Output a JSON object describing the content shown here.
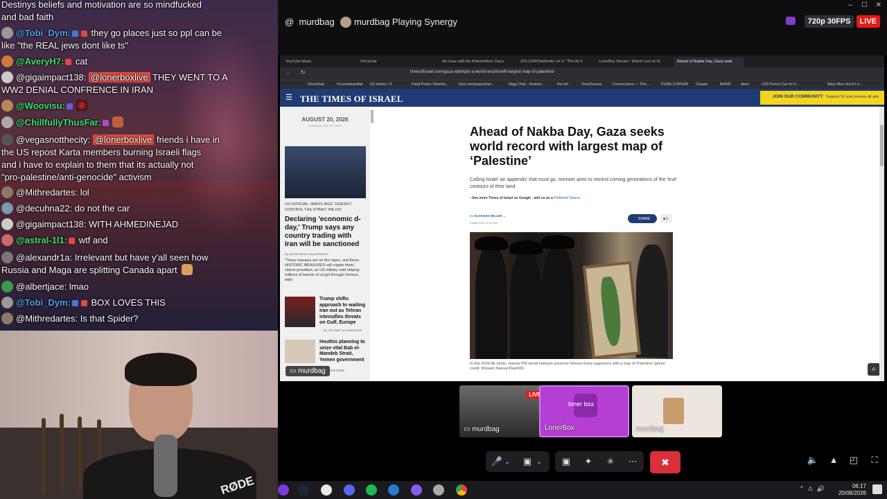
{
  "chat": {
    "messages": [
      {
        "user": "",
        "text": "Destinys beliefs and motivation are so mindfucked"
      },
      {
        "user": "",
        "text": "and bad faith"
      },
      {
        "user": "@Tobi_Dym:",
        "user_color": "#4aa3e8",
        "text": "they go places just so ppl can be",
        "avatar": "#999"
      },
      {
        "user": "",
        "text": "like \"the REAL jews dont like ts\""
      },
      {
        "user": "@AveryH7:",
        "user_color": "#3ee06c",
        "text": "cat",
        "avatar": "#d07a3a"
      },
      {
        "user": "@gigaimpact138:",
        "user_color": "#fff",
        "mention": "@lonerboxlive",
        "text": "THEY WENT TO A",
        "avatar": "#ccc"
      },
      {
        "user": "",
        "text": "WW2 DENIAL CONFRENCE IN IRAN"
      },
      {
        "user": "@Woovisu:",
        "user_color": "#3ee06c",
        "text": "",
        "avatar": "#b88a5a"
      },
      {
        "user": "@ChillfullyThusFar:",
        "user_color": "#3ee06c",
        "text": "",
        "avatar": "#aaa"
      },
      {
        "user": "@vegasnotthecity:",
        "user_color": "#fff",
        "mention": "@lonerboxlive",
        "text": "friends i have in",
        "avatar": "#555"
      },
      {
        "user": "",
        "text": "the US repost Karta members burning Israeli flags"
      },
      {
        "user": "",
        "text": "and i have to explain to them that its actually not"
      },
      {
        "user": "",
        "text": "\"pro-palestine/anti-genocide\" activism"
      },
      {
        "user": "@Mithredartes:",
        "user_color": "#fff",
        "text": "lol",
        "avatar": "#8a7a6a"
      },
      {
        "user": "@decuhna22:",
        "user_color": "#fff",
        "text": "do not the car",
        "avatar": "#7a9ab0"
      },
      {
        "user": "@gigaimpact138:",
        "user_color": "#fff",
        "text": "WITH AHMEDINEJAD",
        "avatar": "#ccc"
      },
      {
        "user": "@astral-1l1:",
        "user_color": "#3ee06c",
        "text": "wtf and",
        "avatar": "#c86a6a"
      },
      {
        "user": "@alexandr1a:",
        "user_color": "#fff",
        "text": "Irrelevant but have y'all seen how",
        "avatar": "#777"
      },
      {
        "user": "",
        "text": "Russia and Maga are splitting Canada apart"
      },
      {
        "user": "@albertjace:",
        "user_color": "#fff",
        "text": "lmao",
        "avatar": "#3a9a4a"
      },
      {
        "user": "@Tobi_Dym:",
        "user_color": "#4aa3e8",
        "text": "BOX LOVES THIS",
        "avatar": "#999"
      },
      {
        "user": "@Mithredartes:",
        "user_color": "#fff",
        "text": "Is that Spider?",
        "avatar": "#8a7a6a"
      }
    ]
  },
  "webcam": {
    "mic_brand": "RØDE"
  },
  "topbar": {
    "username": "murdbag",
    "stream_title": "murdbag Playing Synergy",
    "quality": "720p 30FPS",
    "live": "LIVE"
  },
  "browser": {
    "tabs": [
      "YouTube Music",
      "Omnichat",
      "An issue with the Antisemitism Discu",
      "(20) OSINTdefender on X: \"The Air F",
      "LonerBox Stream - Watch Live on Ki",
      "Ahead of Nakba Day, Gaza seek"
    ],
    "url": "timesofisrael.com/gaza-attempts-a-world-record-with-largest-map-of-palestine/",
    "bookmarks": [
      "Omnichat",
      "r/Livestreamfail",
      "(X) Home / X",
      "Fatal Police Shootin...",
      "kick.com/popout/an...",
      "Digg Chat - Destiny...",
      "the list",
      "TimeGuessr",
      "Connections — The...",
      "PURE COPIUM",
      "Claude",
      "BHND",
      "dens",
      "(19) Punch Cat on X...",
      "Mary Men but it's s..."
    ]
  },
  "site": {
    "logo": "THE TIMES OF ISRAEL",
    "join": "JOIN OUR COMMUNITY",
    "join_sub": "Support ToI and remove all ads",
    "sidebar": {
      "date": "AUGUST 20, 2026",
      "date_sub": "CURRENT TOP STORIES",
      "kicker": "US OFFICIAL: IRAN'S IRGC 'DOESN'T CONTROL THE STRAIT, WE DO'",
      "headline": "Declaring 'economic d-day,' Trump says any country trading with Iran will be sanctioned",
      "byline": "By JACOB MAGID and AGENCIES",
      "body": "'These maniacs are on the ropes, and these HISTORIC MEASURES will cripple them,' claims president, as US military said helping millions of barrels of oil get through Hormuz daily",
      "story2": "Trump shifts approach to waiting Iran out as Tehran intensifies threats on Gulf, Europe",
      "story2_by": "By TOI STAFF and AGENCIES",
      "story3": "Houthis planning to seize vital Bab el-Mandeb Strait, Yemen government",
      "more": "VIEW MORE"
    },
    "article": {
      "headline": "Ahead of Nakba Day, Gaza seeks world record with largest map of ‘Palestine’",
      "subhead": "Calling Israel 'an appendix' that must go, minister aims to remind coming generations of the 'true' contours of their land",
      "gnews": "See more Times of Israel on Google - add us as a",
      "gnews_link": "Preferred Source",
      "byline": "ELHANAN MILLER",
      "date": "9 May 2013, 10:13 pm",
      "share": "SHARE",
      "comments": "1",
      "caption": "In this 2009 file photo, Hamas PM Ismail Haniyeh presents Neturei Karta supporters with a map of 'Palestine' (photo credit: Wissam Nassar/Flash90)"
    },
    "overlay_name": "murdbag"
  },
  "tiles": [
    {
      "name": "murdbag",
      "live": "LIVE"
    },
    {
      "name": "LonerBox",
      "label": "loner box"
    },
    {
      "name": "murdbag"
    }
  ],
  "taskbar": {
    "time": "06:17",
    "date": "20/08/2026"
  },
  "colors": {
    "live_red": "#e91916",
    "toi_blue": "#1f3b73",
    "join_yellow": "#f4d51c",
    "lonerbox_purple": "#b53ed4",
    "end_call_red": "#d9303a"
  }
}
